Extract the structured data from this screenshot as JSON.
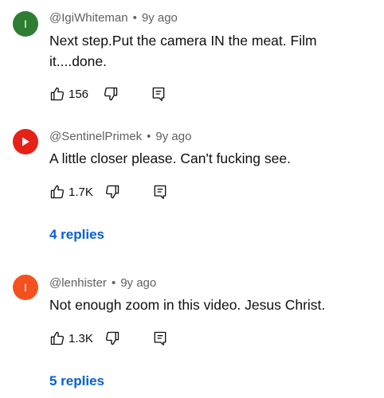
{
  "comments": [
    {
      "avatar_letter": "I",
      "avatar_color": "#2e7d32",
      "author": "@IgiWhiteman",
      "separator": "•",
      "time": "9y ago",
      "text": "Next step.Put the camera IN the meat. Film it....done.",
      "likes": "156"
    },
    {
      "avatar_icon": "play-icon",
      "avatar_color": "#e62117",
      "author": "@SentinelPrimek",
      "separator": "•",
      "time": "9y ago",
      "text": "A little closer please. Can't fucking see.",
      "likes": "1.7K",
      "replies": "4 replies"
    },
    {
      "avatar_letter": "I",
      "avatar_color": "#f4511e",
      "author": "@lenhister",
      "separator": "•",
      "time": "9y ago",
      "text": "Not enough zoom in this video. Jesus Christ.",
      "likes": "1.3K",
      "replies": "5 replies"
    }
  ],
  "icons": [
    "thumb-up-icon",
    "thumb-down-icon",
    "reply-icon"
  ]
}
